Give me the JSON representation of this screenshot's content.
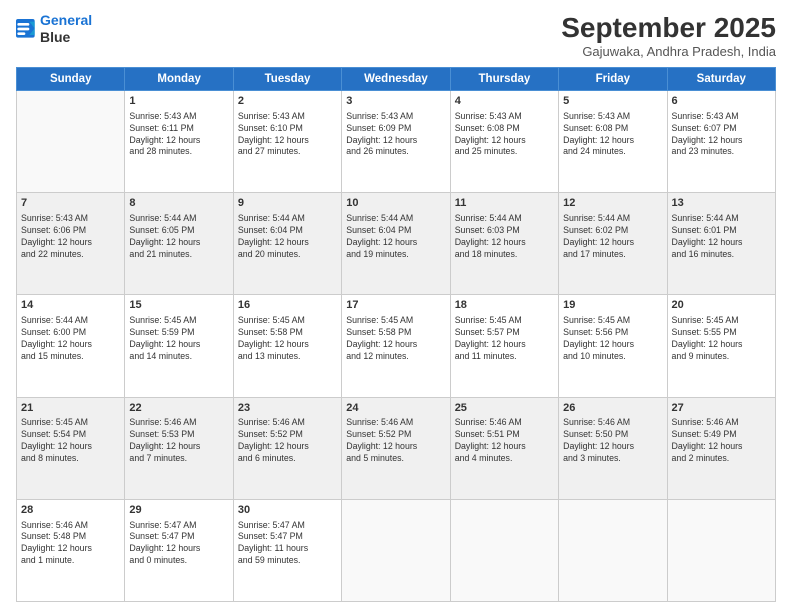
{
  "logo": {
    "line1": "General",
    "line2": "Blue"
  },
  "header": {
    "title": "September 2025",
    "location": "Gajuwaka, Andhra Pradesh, India"
  },
  "weekdays": [
    "Sunday",
    "Monday",
    "Tuesday",
    "Wednesday",
    "Thursday",
    "Friday",
    "Saturday"
  ],
  "weeks": [
    [
      {
        "day": "",
        "info": ""
      },
      {
        "day": "1",
        "info": "Sunrise: 5:43 AM\nSunset: 6:11 PM\nDaylight: 12 hours\nand 28 minutes."
      },
      {
        "day": "2",
        "info": "Sunrise: 5:43 AM\nSunset: 6:10 PM\nDaylight: 12 hours\nand 27 minutes."
      },
      {
        "day": "3",
        "info": "Sunrise: 5:43 AM\nSunset: 6:09 PM\nDaylight: 12 hours\nand 26 minutes."
      },
      {
        "day": "4",
        "info": "Sunrise: 5:43 AM\nSunset: 6:08 PM\nDaylight: 12 hours\nand 25 minutes."
      },
      {
        "day": "5",
        "info": "Sunrise: 5:43 AM\nSunset: 6:08 PM\nDaylight: 12 hours\nand 24 minutes."
      },
      {
        "day": "6",
        "info": "Sunrise: 5:43 AM\nSunset: 6:07 PM\nDaylight: 12 hours\nand 23 minutes."
      }
    ],
    [
      {
        "day": "7",
        "info": "Sunrise: 5:43 AM\nSunset: 6:06 PM\nDaylight: 12 hours\nand 22 minutes."
      },
      {
        "day": "8",
        "info": "Sunrise: 5:44 AM\nSunset: 6:05 PM\nDaylight: 12 hours\nand 21 minutes."
      },
      {
        "day": "9",
        "info": "Sunrise: 5:44 AM\nSunset: 6:04 PM\nDaylight: 12 hours\nand 20 minutes."
      },
      {
        "day": "10",
        "info": "Sunrise: 5:44 AM\nSunset: 6:04 PM\nDaylight: 12 hours\nand 19 minutes."
      },
      {
        "day": "11",
        "info": "Sunrise: 5:44 AM\nSunset: 6:03 PM\nDaylight: 12 hours\nand 18 minutes."
      },
      {
        "day": "12",
        "info": "Sunrise: 5:44 AM\nSunset: 6:02 PM\nDaylight: 12 hours\nand 17 minutes."
      },
      {
        "day": "13",
        "info": "Sunrise: 5:44 AM\nSunset: 6:01 PM\nDaylight: 12 hours\nand 16 minutes."
      }
    ],
    [
      {
        "day": "14",
        "info": "Sunrise: 5:44 AM\nSunset: 6:00 PM\nDaylight: 12 hours\nand 15 minutes."
      },
      {
        "day": "15",
        "info": "Sunrise: 5:45 AM\nSunset: 5:59 PM\nDaylight: 12 hours\nand 14 minutes."
      },
      {
        "day": "16",
        "info": "Sunrise: 5:45 AM\nSunset: 5:58 PM\nDaylight: 12 hours\nand 13 minutes."
      },
      {
        "day": "17",
        "info": "Sunrise: 5:45 AM\nSunset: 5:58 PM\nDaylight: 12 hours\nand 12 minutes."
      },
      {
        "day": "18",
        "info": "Sunrise: 5:45 AM\nSunset: 5:57 PM\nDaylight: 12 hours\nand 11 minutes."
      },
      {
        "day": "19",
        "info": "Sunrise: 5:45 AM\nSunset: 5:56 PM\nDaylight: 12 hours\nand 10 minutes."
      },
      {
        "day": "20",
        "info": "Sunrise: 5:45 AM\nSunset: 5:55 PM\nDaylight: 12 hours\nand 9 minutes."
      }
    ],
    [
      {
        "day": "21",
        "info": "Sunrise: 5:45 AM\nSunset: 5:54 PM\nDaylight: 12 hours\nand 8 minutes."
      },
      {
        "day": "22",
        "info": "Sunrise: 5:46 AM\nSunset: 5:53 PM\nDaylight: 12 hours\nand 7 minutes."
      },
      {
        "day": "23",
        "info": "Sunrise: 5:46 AM\nSunset: 5:52 PM\nDaylight: 12 hours\nand 6 minutes."
      },
      {
        "day": "24",
        "info": "Sunrise: 5:46 AM\nSunset: 5:52 PM\nDaylight: 12 hours\nand 5 minutes."
      },
      {
        "day": "25",
        "info": "Sunrise: 5:46 AM\nSunset: 5:51 PM\nDaylight: 12 hours\nand 4 minutes."
      },
      {
        "day": "26",
        "info": "Sunrise: 5:46 AM\nSunset: 5:50 PM\nDaylight: 12 hours\nand 3 minutes."
      },
      {
        "day": "27",
        "info": "Sunrise: 5:46 AM\nSunset: 5:49 PM\nDaylight: 12 hours\nand 2 minutes."
      }
    ],
    [
      {
        "day": "28",
        "info": "Sunrise: 5:46 AM\nSunset: 5:48 PM\nDaylight: 12 hours\nand 1 minute."
      },
      {
        "day": "29",
        "info": "Sunrise: 5:47 AM\nSunset: 5:47 PM\nDaylight: 12 hours\nand 0 minutes."
      },
      {
        "day": "30",
        "info": "Sunrise: 5:47 AM\nSunset: 5:47 PM\nDaylight: 11 hours\nand 59 minutes."
      },
      {
        "day": "",
        "info": ""
      },
      {
        "day": "",
        "info": ""
      },
      {
        "day": "",
        "info": ""
      },
      {
        "day": "",
        "info": ""
      }
    ]
  ]
}
